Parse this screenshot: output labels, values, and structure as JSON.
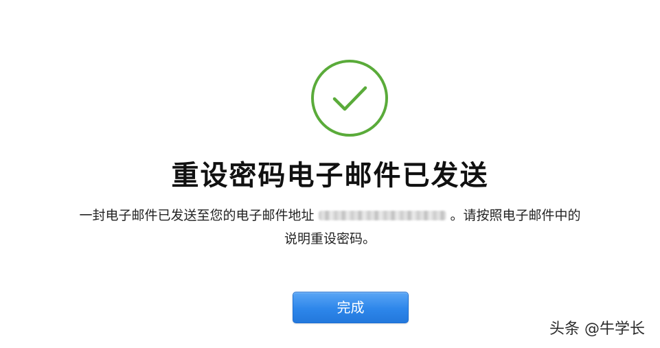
{
  "icon": {
    "name": "checkmark-circle-icon",
    "color": "#5aab3a"
  },
  "title": "重设密码电子邮件已发送",
  "description": {
    "line1_before": "一封电子邮件已发送至您的电子邮件地址",
    "line1_after": "。请按照电子邮件中的",
    "line2": "说明重设密码。"
  },
  "done_button": {
    "label": "完成",
    "color": "#2d86ea"
  },
  "watermark": "头条 @牛学长"
}
